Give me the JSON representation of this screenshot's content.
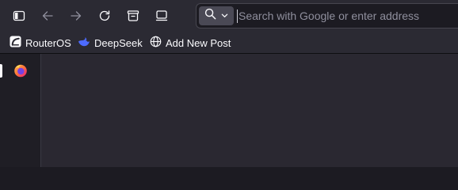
{
  "toolbar": {
    "buttons": [
      {
        "icon": "sidebar-toggle-icon"
      },
      {
        "icon": "back-arrow-icon"
      },
      {
        "icon": "forward-arrow-icon"
      },
      {
        "icon": "reload-icon"
      },
      {
        "icon": "save-to-pocket-icon"
      },
      {
        "icon": "tab-view-icon"
      }
    ]
  },
  "urlbar": {
    "search_engine_icon": "search-icon",
    "placeholder": "Search with Google or enter address",
    "value": ""
  },
  "bookmarks": {
    "items": [
      {
        "label": "RouterOS",
        "icon": "routeros-icon"
      },
      {
        "label": "DeepSeek",
        "icon": "deepseek-icon"
      },
      {
        "label": "Add New Post",
        "icon": "globe-icon"
      }
    ]
  },
  "sidebar": {
    "items": [
      {
        "icon": "firefox-icon",
        "active": true
      }
    ]
  },
  "colors": {
    "toolbar_bg": "#2b2a33",
    "urlbar_bg": "#1c1b22",
    "content_bg": "#2a2831",
    "deepseek_blue": "#4d6bfe",
    "firefox_orange": "#ff7139"
  }
}
